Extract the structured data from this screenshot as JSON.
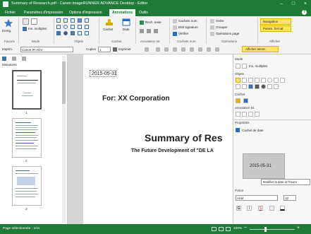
{
  "window": {
    "title": "Summary of Research.pdf - Canon imageRUNNER ADVANCE Desktop - Editor"
  },
  "tabs": [
    "Fichier",
    "Paramètres d'impression",
    "Options d'impression",
    "Annotations",
    "Outils"
  ],
  "active_tab": "Annotations",
  "ribbon": {
    "groups": [
      "Favoris",
      "Mode",
      "Objets",
      "Cachet",
      "Annotation txt",
      "Cachets num.",
      "Opérations",
      "Afficher"
    ],
    "favoris_btn": "Enreg.",
    "mode_btn": "Ins. multiples",
    "cachet_btn": "Cachet",
    "date_btn": "Date",
    "rech_texte": "Rech. texte",
    "cachets_num_btn": "Cachets num.",
    "etat_signature": "Etat signature",
    "verifier": "Vérifier",
    "ordre": "Ordre",
    "grouper": "Grouper",
    "operations_page": "Opérations page",
    "navigation": "Navigation",
    "param_format": "Param. format",
    "afficher_annot": "Afficher annot."
  },
  "toolbar": {
    "printer_label": "Imprim.",
    "printer_value": "Canon iR-ADV",
    "copies_label": "Copies",
    "copies_value": "1",
    "imprimer_btn": "Imprimer"
  },
  "left_pane": {
    "title": "Miniatures",
    "page_numbers": [
      "1",
      "2",
      "3"
    ]
  },
  "document": {
    "date": "2015-05-31",
    "for_line": "For: XX Corporation",
    "title": "Summary of Res",
    "subtitle": "The Future Development of \"DE LA"
  },
  "right_pane": {
    "mode_label": "Mode",
    "mode_btn": "Ins. multiples",
    "objets_label": "Objets",
    "cachet_label": "Cachet",
    "annotation_label": "Annotation txt",
    "proprietes_label": "Propriétés",
    "cachet_de_date": "Cachet de date",
    "preview_date": "2015-05-31",
    "modify_btn": "Modifier la date et l'heure",
    "police_label": "Police",
    "font_value": "Arial",
    "font_size": "12"
  },
  "status": {
    "page_info": "Page sélectionnée : 1/11",
    "zoom": "100%"
  },
  "colors": {
    "brand_green": "#1f7a38",
    "highlight_yellow": "#ffe36b"
  }
}
